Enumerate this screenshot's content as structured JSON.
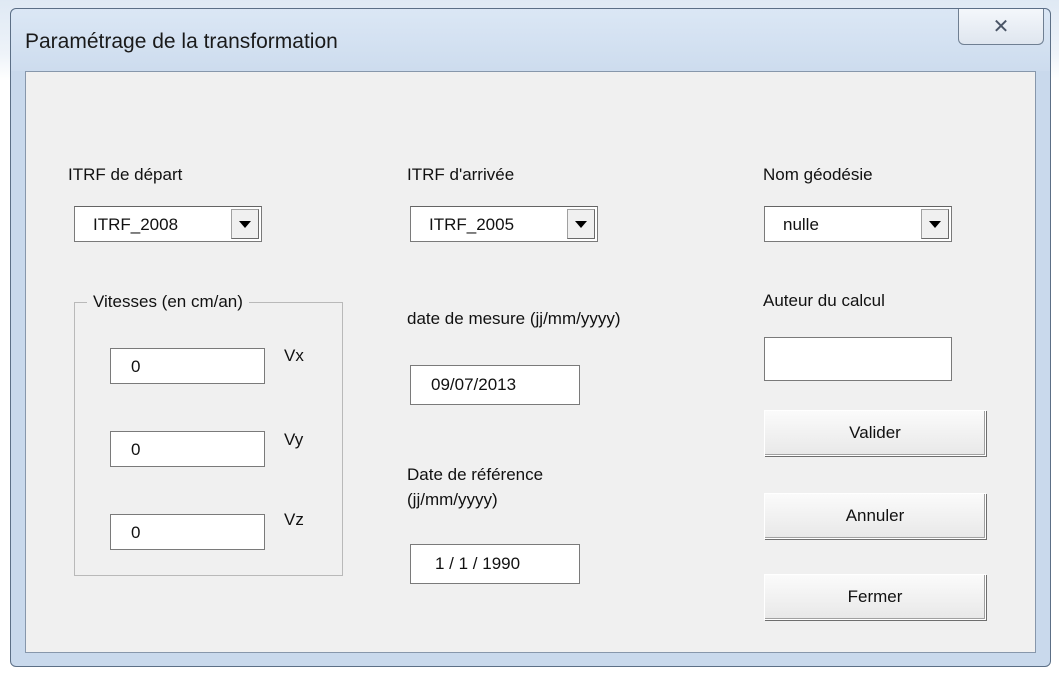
{
  "window": {
    "title": "Paramétrage de la transformation",
    "close_glyph": "✕"
  },
  "itrf_depart": {
    "label": "ITRF de départ",
    "value": "ITRF_2008"
  },
  "itrf_arrivee": {
    "label": "ITRF d'arrivée",
    "value": "ITRF_2005"
  },
  "nom_geodesie": {
    "label": "Nom géodésie",
    "value": "nulle"
  },
  "date_mesure": {
    "label": "date de mesure (jj/mm/yyyy)",
    "value": "09/07/2013"
  },
  "date_reference": {
    "label_line1": "Date de référence",
    "label_line2": "(jj/mm/yyyy)",
    "value": "1 / 1 / 1990"
  },
  "auteur": {
    "label": "Auteur du calcul",
    "value": ""
  },
  "vitesses": {
    "caption": "Vitesses (en cm/an)",
    "vx": {
      "label": "Vx",
      "value": "0"
    },
    "vy": {
      "label": "Vy",
      "value": "0"
    },
    "vz": {
      "label": "Vz",
      "value": "0"
    }
  },
  "buttons": {
    "valider": "Valider",
    "annuler": "Annuler",
    "fermer": "Fermer"
  },
  "icons": {
    "dropdown": "chevron-down-icon",
    "close": "close-icon"
  },
  "colors": {
    "frame": "#c9d9ec",
    "client": "#f0f0f0"
  }
}
